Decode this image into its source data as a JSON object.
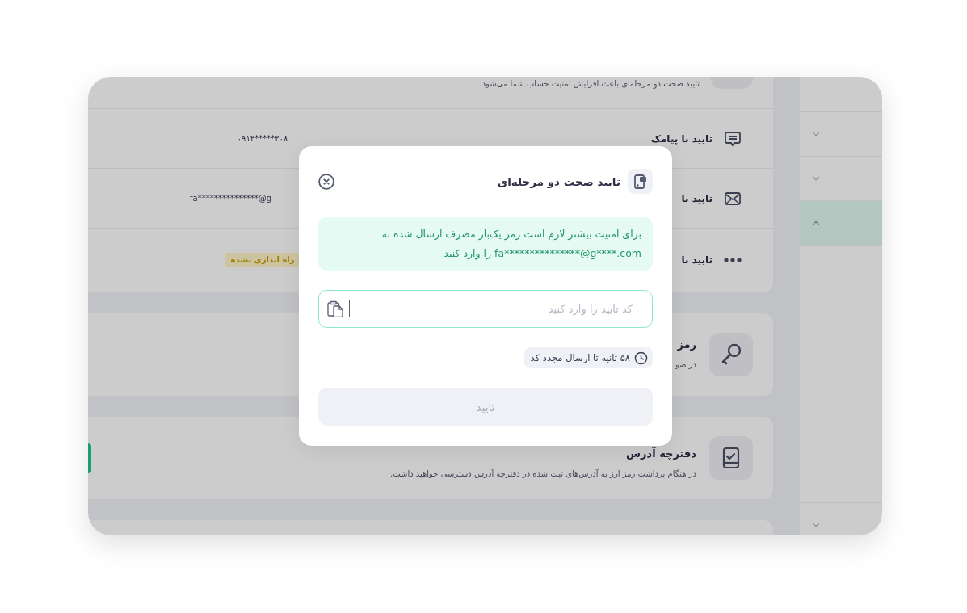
{
  "background": {
    "intro": "تایید صحت دو مرحله‌ای باعث افزایش امنیت حساب شما می‌شود.",
    "methods": [
      {
        "kind": "sms",
        "title": "تایید با پیامک",
        "value": "۰۹۱۲*****۲۰۸"
      },
      {
        "kind": "email",
        "title": "تایید با",
        "value": "fa***************@g"
      },
      {
        "kind": "app",
        "title": "تایید با",
        "status": "راه اندازی نشده"
      }
    ],
    "cards": [
      {
        "kind": "key",
        "title": "رمز",
        "description": "در صو"
      },
      {
        "kind": "address_book",
        "title": "دفترچه آدرس",
        "description": "در هنگام برداشت رمز ارز به آدرس‌های ثبت شده در دفترچه آدرس دسترسی خواهید داشت."
      }
    ],
    "sidebar": {
      "items": [
        {
          "selected": false,
          "expanded": false
        },
        {
          "selected": false,
          "expanded": false
        },
        {
          "selected": true,
          "expanded": true
        },
        {
          "selected": false,
          "expanded": false
        }
      ]
    }
  },
  "dialog": {
    "title": "تایید صحت دو مرحله‌ای",
    "notice": "برای امنیت بیشتر لازم است رمز یک‌بار مصرف ارسال شده به fa***************@g****.com را وارد کنید",
    "code_field": {
      "placeholder": "کد تایید را وارد کنید"
    },
    "resend_timer": "۵۸ ثانیه تا ارسال مجدد کد",
    "confirm_button": {
      "label": "تایید",
      "disabled": true
    }
  }
}
